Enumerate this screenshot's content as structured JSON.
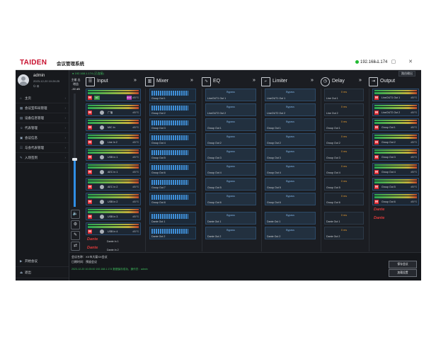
{
  "window": {
    "logo": "TAIDEN",
    "title": "会议管理系统",
    "ip": "192.168.1.174",
    "controls": "— ▢ ✕"
  },
  "user": {
    "name": "admin",
    "date": "2023-12-20 10:28:25",
    "icons": "⏻  ⚙"
  },
  "nav": {
    "items": [
      {
        "label": "主页",
        "icon": "⌂"
      },
      {
        "label": "会议室布局管理",
        "icon": "▦"
      },
      {
        "label": "设备信息管理",
        "icon": "▤"
      },
      {
        "label": "代表管理",
        "icon": "☺"
      },
      {
        "label": "会议信息",
        "icon": "▣"
      },
      {
        "label": "与会代表管理",
        "icon": "☷"
      },
      {
        "label": "入场签到",
        "icon": "✎"
      }
    ],
    "bottom": [
      {
        "label": "开始会议",
        "icon": "▶"
      },
      {
        "label": "退出",
        "icon": "⏏"
      }
    ],
    "chevron": "›"
  },
  "status": {
    "line": "● 192.168.1.174 (已连接)"
  },
  "volume": {
    "top_label": "主输\n出",
    "label2": "增益",
    "db": "-30 dB",
    "level": 0.42
  },
  "header": {
    "input": "Input",
    "mixer": "Mixer",
    "eq": "EQ",
    "limiter": "Limiter",
    "delay": "Delay",
    "output": "Output",
    "arrows": "»",
    "dropdown": "路由输出"
  },
  "input_channels": [
    {
      "label": "",
      "tags": true
    },
    {
      "label": "广播",
      "tags": false
    },
    {
      "label": "MIC In",
      "tags": false
    },
    {
      "label": "Line In 2",
      "tags": false
    },
    {
      "label": "USB In 1",
      "tags": false
    },
    {
      "label": "AEC In 1",
      "tags": false
    },
    {
      "label": "AEC In 2",
      "tags": false
    },
    {
      "label": "USB In 2",
      "tags": false
    },
    {
      "label": "USB In 3",
      "tags": false
    },
    {
      "label": "USB In 4",
      "tags": false
    }
  ],
  "input_dante": [
    {
      "label": "Dante In 1"
    },
    {
      "label": "Dante In 2"
    }
  ],
  "mute_label": "M",
  "tag_a": "AC",
  "tag_b": "ANC",
  "db_suffix": "dBFS",
  "dante_text": "Dante",
  "mixer_cards": [
    "Group Out 1",
    "Group Out 2",
    "Group Out 3",
    "Group Out 4",
    "Group Out 5",
    "Group Out 6",
    "Group Out 7",
    "Group Out 8",
    "Dante Out 1",
    "Dante Out 2"
  ],
  "eq_bypass": "Bypass",
  "eq_cards": [
    "LineOUT1 Out 1",
    "LineOUT2 Out 2",
    "Group Out 1",
    "Group Out 2",
    "Group Out 3",
    "Group Out 4",
    "Group Out 5",
    "Group Out 6",
    "Dante Out 1",
    "Dante Out 2"
  ],
  "limiter_cards": [
    "LineOUT1 Out 1",
    "LineOUT2 Out 2",
    "Group Out 1",
    "Group Out 2",
    "Group Out 3",
    "Group Out 4",
    "Group Out 5",
    "Group Out 6",
    "Dante Out 1",
    "Dante Out 2"
  ],
  "delay_time": "0 ms",
  "delay_cards": [
    "Line Out 1",
    "Line Out 2",
    "Group Out 1",
    "Group Out 2",
    "Group Out 3",
    "Group Out 4",
    "Group Out 5",
    "Group Out 6",
    "Dante Out 1",
    "Dante Out 2"
  ],
  "output_cards": [
    "LineOUT1 Out 1",
    "LineOUT2 Out 2",
    "Group Out 1",
    "Group Out 2",
    "Group Out 3",
    "Group Out 4",
    "Group Out 5",
    "Group Out 6",
    "Dante Out 1",
    "Dante Out 2"
  ],
  "console": {
    "line1": "会议名称：XX市大厦XX会议",
    "line2": "日期时间：预留会议",
    "log": "2023-12-20 10:25:00 192.168.1.174 数据保存成功，操作员：admin",
    "btn1": "保存会议",
    "btn2": "加载设置"
  },
  "colors": {
    "accent": "#2f8de4",
    "mute": "#e12b33",
    "dante": "#e03a3a",
    "delay": "#e39a2f"
  }
}
